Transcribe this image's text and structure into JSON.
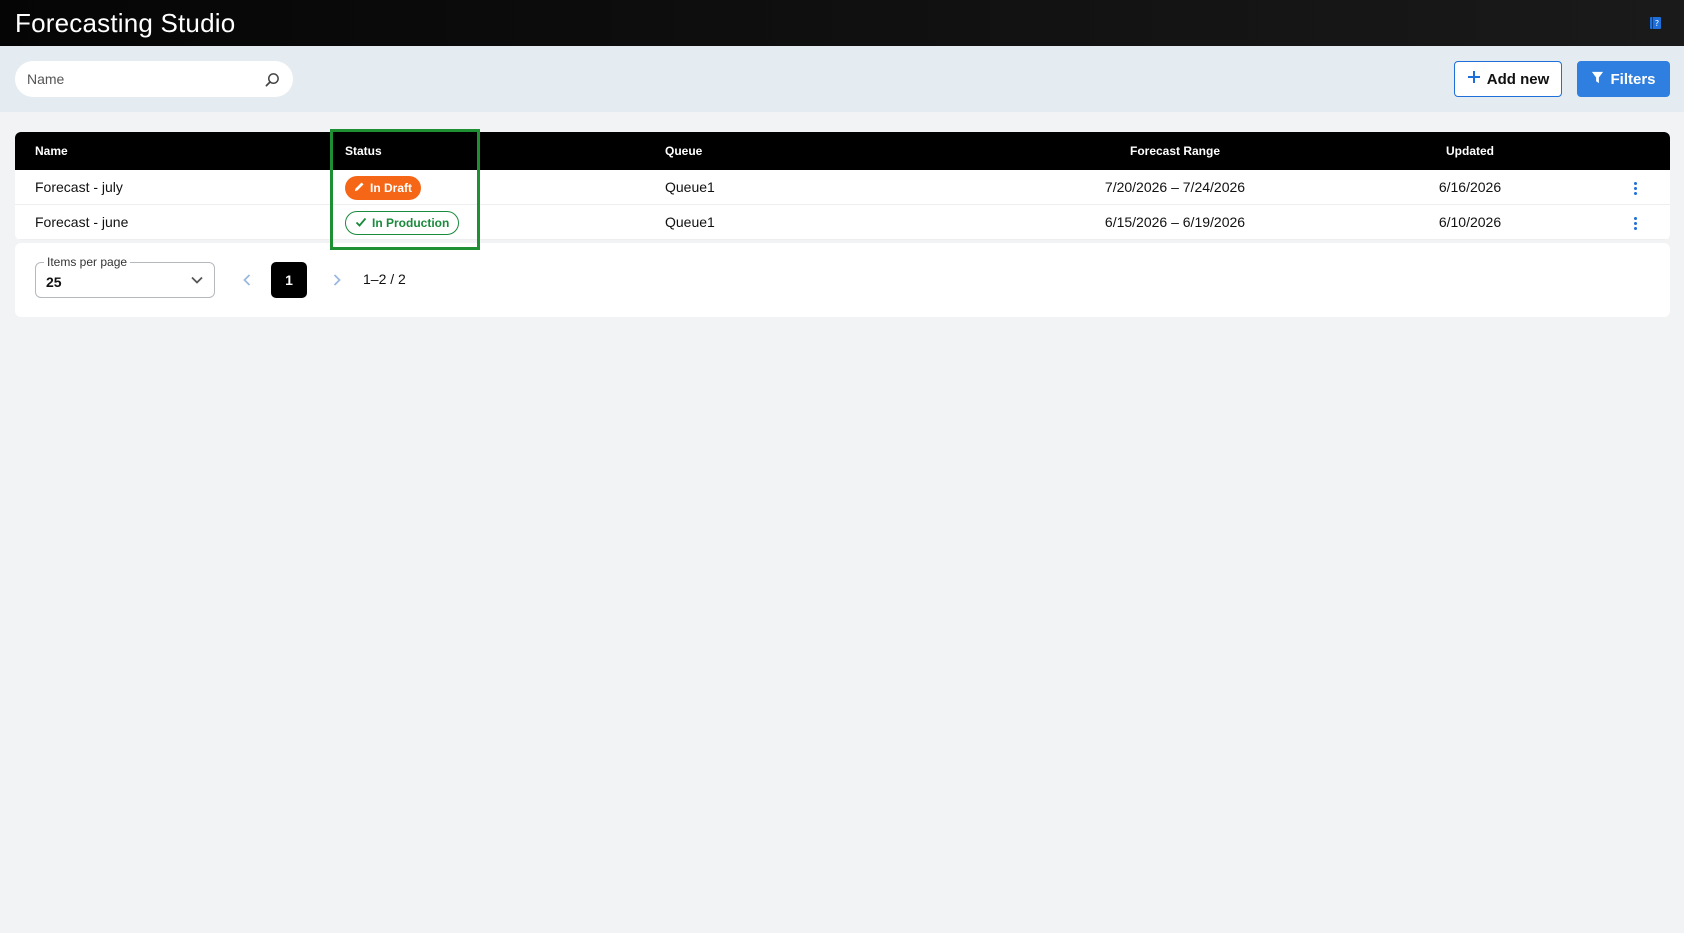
{
  "app": {
    "title": "Forecasting Studio",
    "help_icon": "help-book-icon"
  },
  "toolbar": {
    "search_placeholder": "Name",
    "add_label": "Add new",
    "filters_label": "Filters"
  },
  "table": {
    "headers": {
      "name": "Name",
      "status": "Status",
      "queue": "Queue",
      "range": "Forecast Range",
      "updated": "Updated"
    },
    "rows": [
      {
        "name": "Forecast - july",
        "status": "In Draft",
        "status_type": "draft",
        "queue": "Queue1",
        "range": "7/20/2026 – 7/24/2026",
        "updated": "6/16/2026"
      },
      {
        "name": "Forecast - june",
        "status": "In Production",
        "status_type": "production",
        "queue": "Queue1",
        "range": "6/15/2026 – 6/19/2026",
        "updated": "6/10/2026"
      }
    ]
  },
  "pagination": {
    "items_per_page_label": "Items per page",
    "items_per_page_value": "25",
    "current_page": "1",
    "range_text": "1–2 / 2"
  },
  "colors": {
    "accent_blue": "#2f7fe0",
    "draft_orange": "#f56616",
    "production_green": "#1a8a3c",
    "highlight_green": "#1e8f32"
  }
}
